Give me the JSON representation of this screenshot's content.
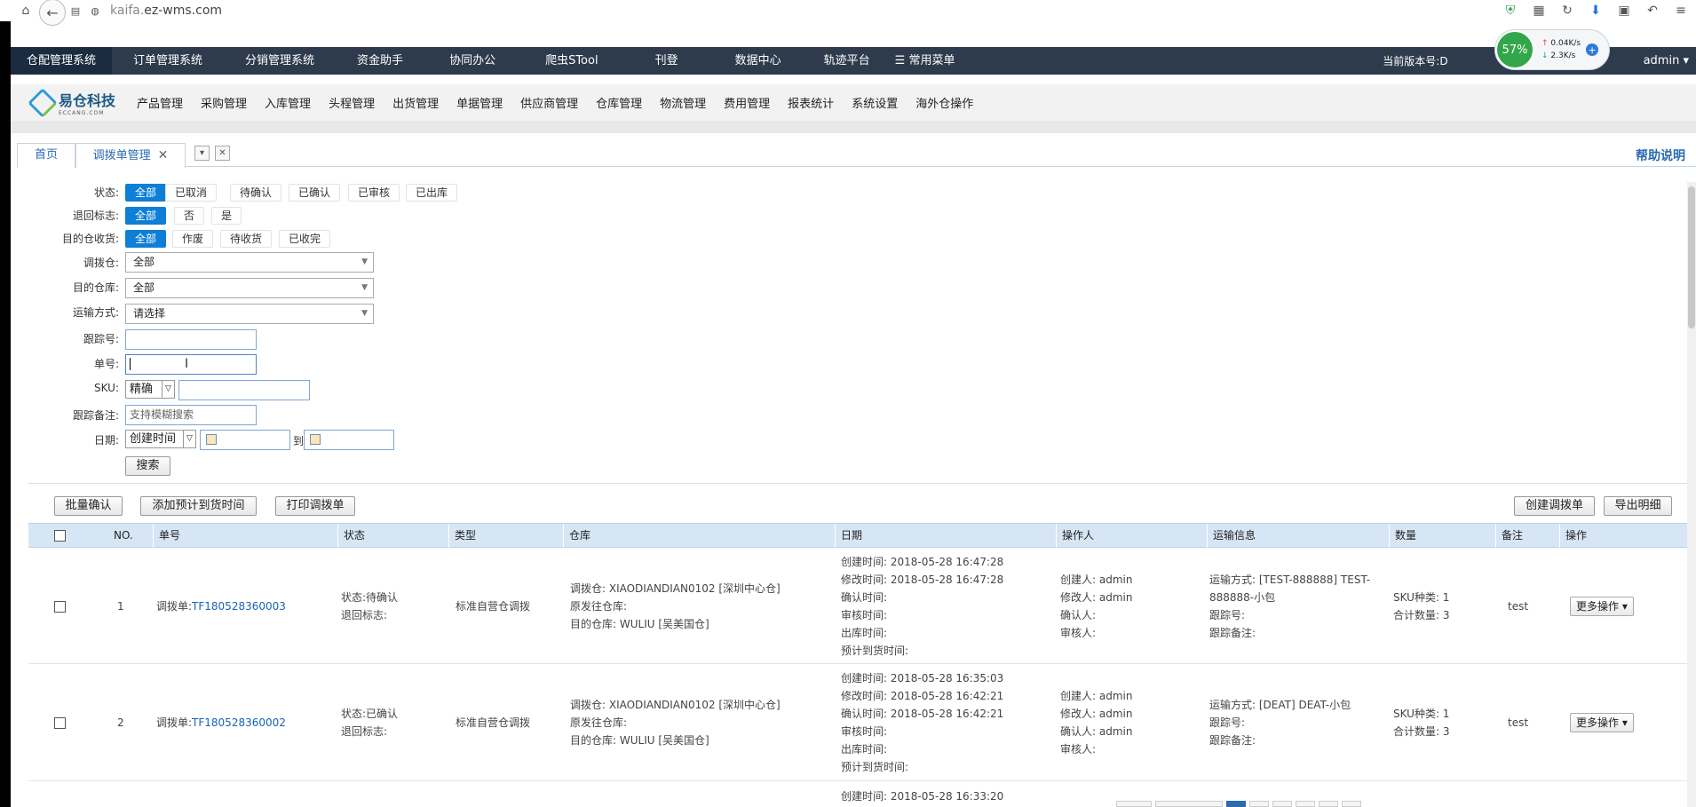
{
  "browser": {
    "url_sub": "kaifa.",
    "url_domain": "ez-wms.com"
  },
  "topnav": {
    "items": [
      "仓配管理系统",
      "订单管理系统",
      "分销管理系统",
      "资金助手",
      "协同办公",
      "爬虫STool",
      "刊登",
      "数据中心",
      "轨迹平台",
      "常用菜单"
    ],
    "version_label": "当前版本号:D",
    "user": "admin",
    "speed": {
      "percent": "57%",
      "up": "0.04K/s",
      "down": "2.3K/s"
    }
  },
  "subnav": {
    "logo_text": "易仓科技",
    "logo_sub": "ECCANG.COM",
    "items": [
      "产品管理",
      "采购管理",
      "入库管理",
      "头程管理",
      "出货管理",
      "单据管理",
      "供应商管理",
      "仓库管理",
      "物流管理",
      "费用管理",
      "报表统计",
      "系统设置",
      "海外仓操作"
    ]
  },
  "tabs": {
    "home": "首页",
    "current": "调拨单管理",
    "help": "帮助说明"
  },
  "filters": {
    "status_label": "状态:",
    "status_options": [
      "全部",
      "已取消",
      "待确认",
      "已确认",
      "已审核",
      "已出库"
    ],
    "return_label": "退回标志:",
    "return_options": [
      "全部",
      "否",
      "是"
    ],
    "receive_label": "目的仓收货:",
    "receive_options": [
      "全部",
      "作废",
      "待收货",
      "已收完"
    ],
    "from_wh_label": "调拨仓:",
    "from_wh_value": "全部",
    "to_wh_label": "目的仓库:",
    "to_wh_value": "全部",
    "ship_label": "运输方式:",
    "ship_value": "请选择",
    "track_label": "跟踪号:",
    "order_label": "单号:",
    "sku_label": "SKU:",
    "sku_mode": "精确",
    "note_label": "跟踪备注:",
    "note_placeholder": "支持模糊搜索",
    "date_label": "日期:",
    "date_type": "创建时间",
    "date_to": "到",
    "search_btn": "搜索"
  },
  "actions": {
    "batch_confirm": "批量确认",
    "add_eta": "添加预计到货时间",
    "print": "打印调拨单",
    "create": "创建调拨单",
    "export": "导出明细"
  },
  "table": {
    "headers": [
      "NO.",
      "单号",
      "状态",
      "类型",
      "仓库",
      "日期",
      "操作人",
      "运输信息",
      "数量",
      "备注",
      "操作"
    ],
    "rows": [
      {
        "no": "1",
        "order_prefix": "调拨单:",
        "order_no": "TF180528360003",
        "status": "状态:待确认",
        "return_flag": "退回标志:",
        "type": "标准自营仓调拨",
        "wh_from": "调拨仓: XIAODIANDIAN0102 [深圳中心仓]",
        "wh_origin": "原发往仓库:",
        "wh_to": "目的仓库: WULIU [吴美国仓]",
        "d_create": "创建时间: 2018-05-28 16:47:28",
        "d_modify": "修改时间: 2018-05-28 16:47:28",
        "d_confirm": "确认时间:",
        "d_audit": "审核时间:",
        "d_out": "出库时间:",
        "d_eta": "预计到货时间:",
        "op_create": "创建人: admin",
        "op_modify": "修改人: admin",
        "op_confirm": "确认人:",
        "op_audit": "审核人:",
        "ship_1": "运输方式: [TEST-888888] TEST-",
        "ship_2": "888888-小包",
        "ship_track": "跟踪号:",
        "ship_note": "跟踪备注:",
        "qty_sku": "SKU种类: 1",
        "qty_total": "合计数量: 3",
        "remark": "test",
        "more": "更多操作"
      },
      {
        "no": "2",
        "order_prefix": "调拨单:",
        "order_no": "TF180528360002",
        "status": "状态:已确认",
        "return_flag": "退回标志:",
        "type": "标准自营仓调拨",
        "wh_from": "调拨仓: XIAODIANDIAN0102 [深圳中心仓]",
        "wh_origin": "原发往仓库:",
        "wh_to": "目的仓库: WULIU [吴美国仓]",
        "d_create": "创建时间: 2018-05-28 16:35:03",
        "d_modify": "修改时间: 2018-05-28 16:42:21",
        "d_confirm": "确认时间: 2018-05-28 16:42:21",
        "d_audit": "审核时间:",
        "d_out": "出库时间:",
        "d_eta": "预计到货时间:",
        "op_create": "创建人: admin",
        "op_modify": "修改人: admin",
        "op_confirm": "确认人: admin",
        "op_audit": "审核人:",
        "ship_1": "运输方式: [DEAT] DEAT-小包",
        "ship_track": "跟踪号:",
        "ship_note": "跟踪备注:",
        "qty_sku": "SKU种类: 1",
        "qty_total": "合计数量: 3",
        "remark": "test",
        "more": "更多操作"
      }
    ],
    "partial_row_date": "创建时间: 2018-05-28 16:33:20"
  }
}
